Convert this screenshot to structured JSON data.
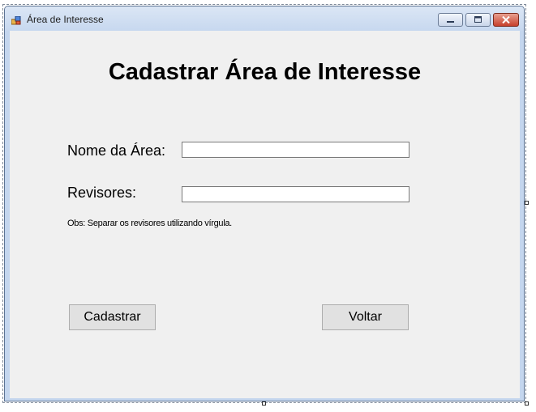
{
  "window": {
    "title": "Área de Interesse",
    "minimize_glyph": "–",
    "maximize_glyph": "□",
    "close_glyph": "✕"
  },
  "form": {
    "heading": "Cadastrar Área de Interesse",
    "area_name_label": "Nome da Área:",
    "area_name_value": "",
    "reviewers_label": "Revisores:",
    "reviewers_value": "",
    "note": "Obs: Separar os revisores utilizando vírgula."
  },
  "buttons": {
    "register_label": "Cadastrar",
    "back_label": "Voltar"
  },
  "icons": {
    "app": "form-app-icon",
    "minimize": "minimize-icon",
    "maximize": "maximize-icon",
    "close": "close-icon"
  },
  "colors": {
    "titlebar": "#c7d8ef",
    "client_background": "#f0f0f0",
    "close_button": "#c7402c",
    "button_face": "#e1e1e1"
  }
}
